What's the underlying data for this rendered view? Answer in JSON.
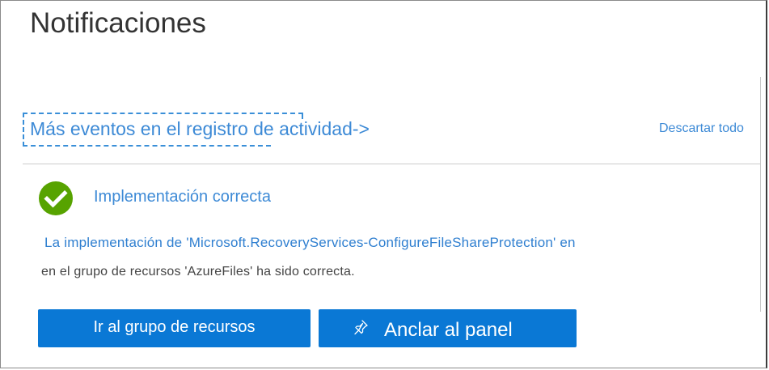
{
  "panel": {
    "title": "Notificaciones",
    "activity_log_link": "Más eventos en el registro de actividad->",
    "dismiss_all": "Descartar todo"
  },
  "notification": {
    "status_icon": "checkmark-circle-icon",
    "status_color": "#57a300",
    "title": "Implementación correcta",
    "message_line1": "La implementación de 'Microsoft.RecoveryServices-ConfigureFileShareProtection' en",
    "message_line2": "en el grupo de recursos 'AzureFiles' ha sido correcta.",
    "actions": {
      "go_to_resource_group": "Ir al grupo de recursos",
      "pin_to_dashboard": "Anclar al panel",
      "pin_icon": "pin-icon"
    }
  },
  "colors": {
    "accent": "#0a78d5",
    "link": "#3d8ad6",
    "title_text": "#333333"
  }
}
